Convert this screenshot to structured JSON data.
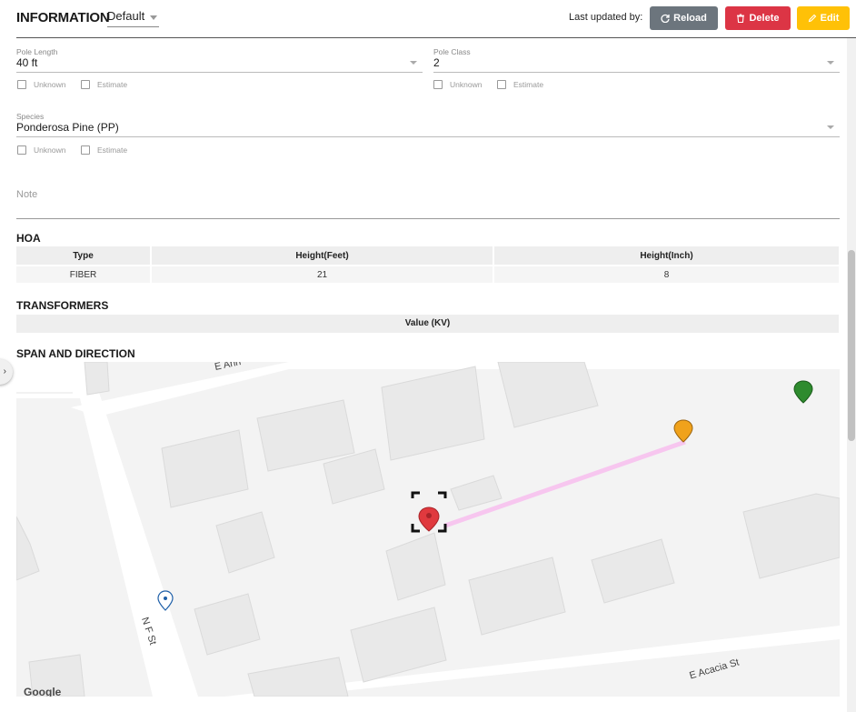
{
  "header": {
    "title": "INFORMATION",
    "view_value": "Default",
    "last_updated_label": "Last updated by:",
    "reload_label": "Reload",
    "delete_label": "Delete",
    "edit_label": "Edit"
  },
  "fields": {
    "pole_length": {
      "label": "Pole Length",
      "value": "40 ft"
    },
    "pole_class": {
      "label": "Pole Class",
      "value": "2"
    },
    "species": {
      "label": "Species",
      "value": "Ponderosa Pine (PP)"
    },
    "unknown_label": "Unknown",
    "estimate_label": "Estimate",
    "note_placeholder": "Note"
  },
  "hoa": {
    "title": "HOA",
    "columns": [
      "Type",
      "Height(Feet)",
      "Height(Inch)"
    ],
    "rows": [
      [
        "FIBER",
        "21",
        "8"
      ]
    ]
  },
  "transformers": {
    "title": "TRANSFORMERS",
    "columns": [
      "Value (KV)"
    ]
  },
  "span": {
    "title": "SPAN AND DIRECTION",
    "streets": [
      "E Acacia St",
      "N F St",
      "E Ann"
    ],
    "map_logo": "Google"
  },
  "colors": {
    "reload": "#6c757d",
    "delete": "#dc3545",
    "edit": "#ffc107",
    "span_line": "#f7c6ef",
    "marker_red": "#e0393e",
    "marker_orange": "#f0a21b",
    "marker_green": "#2e8b2e",
    "marker_blue": "#1e5fa8"
  }
}
